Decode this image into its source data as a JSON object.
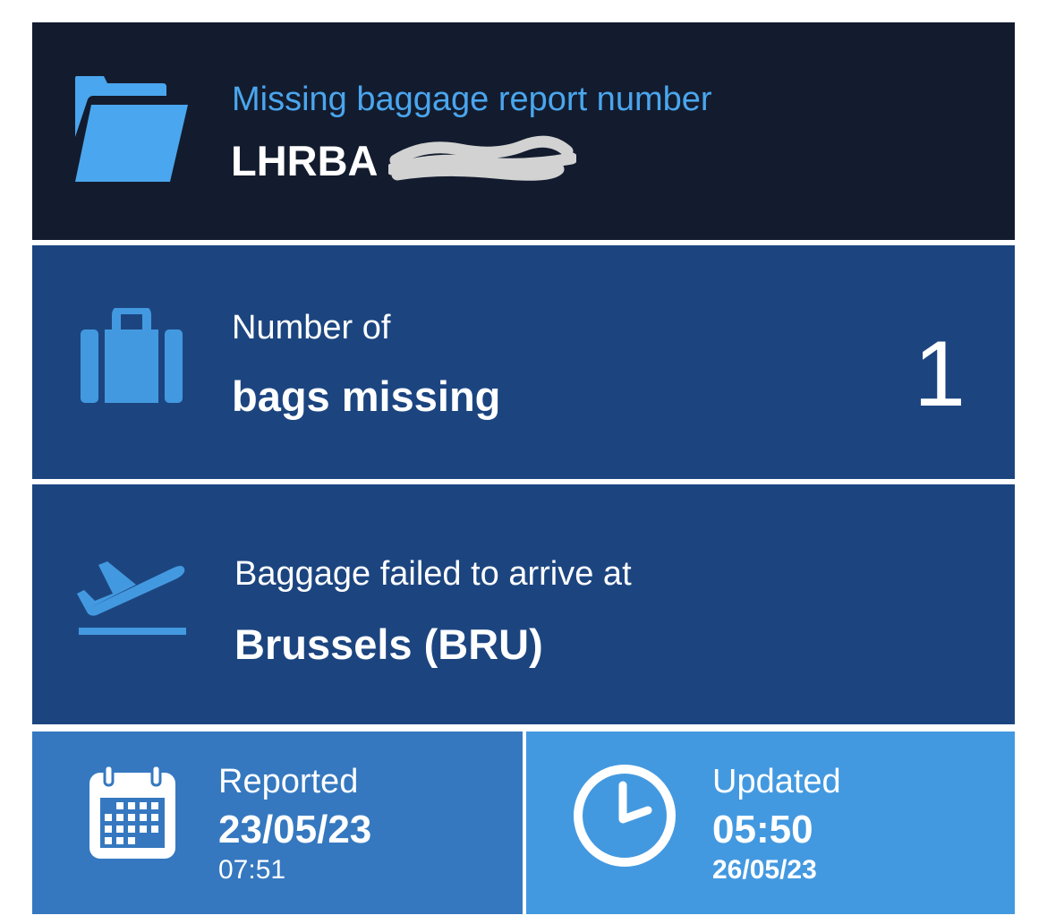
{
  "report": {
    "label": "Missing baggage report number",
    "number": "LHRBA",
    "icon": "folder-icon",
    "accent": "#4aa6ee"
  },
  "bags": {
    "label": "Number of",
    "value_label": "bags missing",
    "count": "1",
    "icon": "suitcase-icon"
  },
  "arrival": {
    "label": "Baggage failed to arrive at",
    "airport": "Brussels (BRU)",
    "icon": "plane-departure-icon"
  },
  "reported": {
    "label": "Reported",
    "date": "23/05/23",
    "time": "07:51",
    "icon": "calendar-icon"
  },
  "updated": {
    "label": "Updated",
    "time": "05:50",
    "date": "26/05/23",
    "icon": "clock-icon"
  },
  "colors": {
    "dark_navy": "#131c2e",
    "navy": "#1c4580",
    "mid_blue": "#3578c0",
    "light_blue": "#4399e0"
  }
}
